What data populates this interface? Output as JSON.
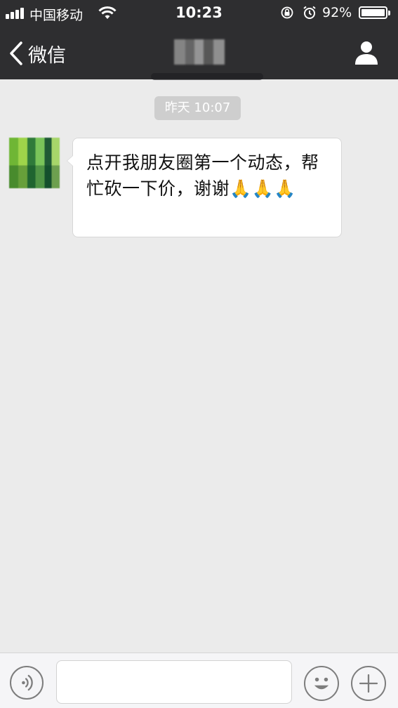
{
  "status_bar": {
    "carrier": "中国移动",
    "time": "10:23",
    "battery_percent": "92%",
    "icons": [
      "signal-icon",
      "wifi-icon",
      "orientation-lock-icon",
      "alarm-icon",
      "battery-icon"
    ]
  },
  "nav": {
    "back_label": "微信",
    "title_obscured": true,
    "profile_icon": "person-icon"
  },
  "chat": {
    "timestamp": "昨天 10:07",
    "messages": [
      {
        "from": "contact",
        "avatar_obscured": true,
        "text": "点开我朋友圈第一个动态，帮忙砍一下价，谢谢🙏🙏🙏"
      }
    ]
  },
  "input_bar": {
    "voice_icon": "voice-icon",
    "input_value": "",
    "emoji_icon": "emoji-face-icon",
    "more_icon": "plus-icon"
  },
  "colors": {
    "nav_background": "#2e2e30",
    "chat_background": "#ebebeb",
    "timestamp_background": "#cecece",
    "bubble_background": "#ffffff",
    "input_bar_background": "#f5f5f7"
  }
}
